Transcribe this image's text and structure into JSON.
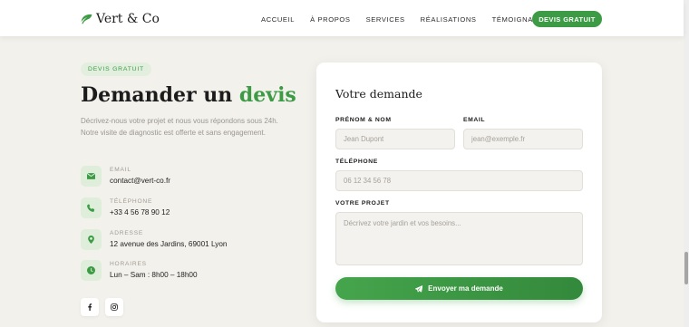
{
  "header": {
    "logo_text": "Vert & Co",
    "logo_icon": "leaf-icon",
    "nav": [
      "Accueil",
      "À propos",
      "Services",
      "Réalisations",
      "Témoignages"
    ],
    "cta_label": "Devis gratuit"
  },
  "contact_section": {
    "badge": "Devis gratuit",
    "heading_main": "Demander un",
    "heading_accent": "devis",
    "intro": "Décrivez-nous votre projet et nous vous répondons sous 24h. Notre visite de diagnostic est offerte et sans engagement.",
    "items": [
      {
        "icon": "envelope-icon",
        "label": "Email",
        "value": "contact@vert-co.fr"
      },
      {
        "icon": "phone-icon",
        "label": "Téléphone",
        "value": "+33 4 56 78 90 12"
      },
      {
        "icon": "map-pin-icon",
        "label": "Adresse",
        "value": "12 avenue des Jardins, 69001 Lyon"
      },
      {
        "icon": "clock-icon",
        "label": "Horaires",
        "value": "Lun – Sam : 8h00 – 18h00"
      }
    ],
    "social": [
      "facebook-icon",
      "instagram-icon"
    ]
  },
  "form": {
    "title": "Votre demande",
    "name_label": "Prénom & nom",
    "name_placeholder": "Jean Dupont",
    "email_label": "Email",
    "email_placeholder": "jean@exemple.fr",
    "phone_label": "Téléphone",
    "phone_placeholder": "06 12 34 56 78",
    "project_label": "Votre projet",
    "project_placeholder": "Décrivez votre jardin et vos besoins...",
    "submit_label": "Envoyer ma demande",
    "submit_icon": "paper-plane-icon"
  },
  "colors": {
    "accent": "#3d9a45",
    "background": "#f3f1ec"
  }
}
